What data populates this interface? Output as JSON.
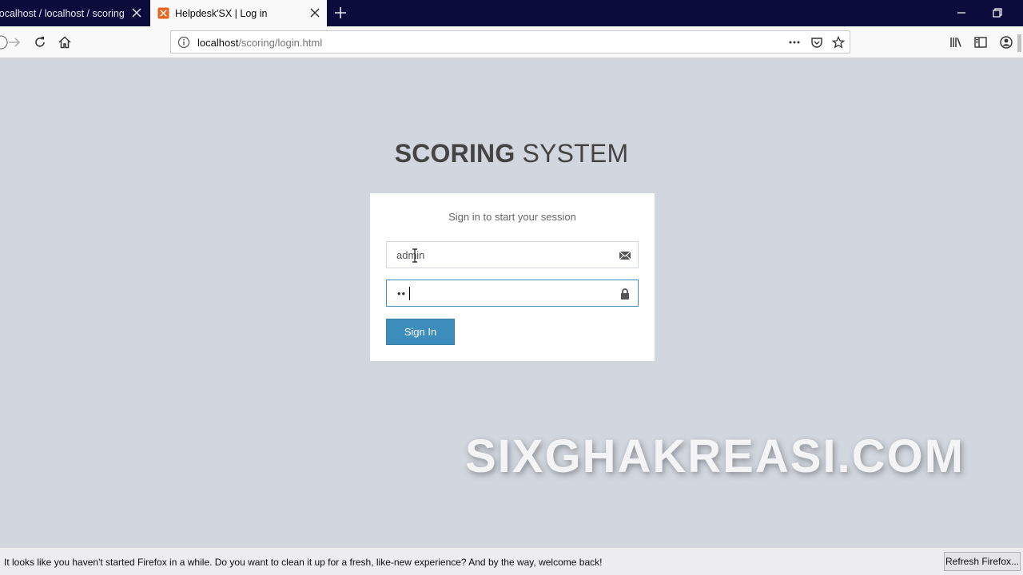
{
  "tabs": [
    {
      "title": "localhost / localhost / scoring | phpMyAdmin",
      "active": false
    },
    {
      "title": "Helpdesk'SX | Log in",
      "active": true
    }
  ],
  "navbar": {
    "url_host": "localhost",
    "url_path": "/scoring/login.html"
  },
  "page": {
    "brand_bold": "SCORING",
    "brand_light": " SYSTEM",
    "login_message": "Sign in to start your session",
    "username_value": "admin",
    "password_mask": "••",
    "signin_label": "Sign In"
  },
  "watermark": "SIXGHAKREASI.COM",
  "notification": {
    "text": "It looks like you haven't started Firefox in a while. Do you want to clean it up for a fresh, like-new experience? And by the way, welcome back!",
    "button_label": "Refresh Firefox..."
  },
  "colors": {
    "page_bg": "#d2d6de",
    "primary": "#3c8dbc",
    "tab_bar": "#0c0c3c"
  }
}
